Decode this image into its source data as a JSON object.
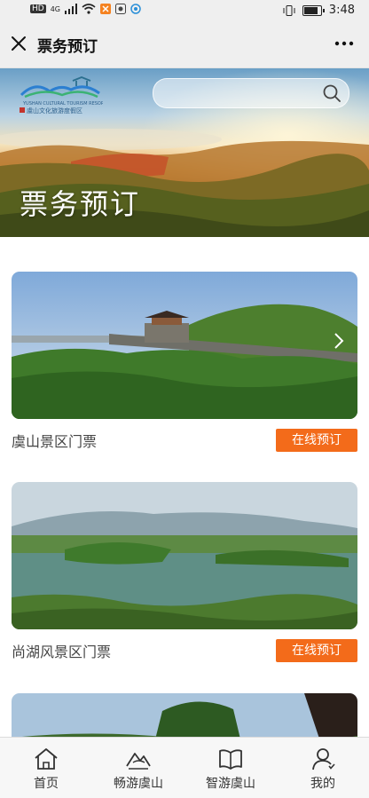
{
  "status_bar": {
    "left_text": "HD",
    "signal_label": "4G",
    "time": "3:48"
  },
  "nav": {
    "title": "票务预订",
    "close_icon": "close-icon",
    "more_icon": "more-icon"
  },
  "banner": {
    "title": "票务预订",
    "logo_text": "虞山文化旅游度假区",
    "logo_subtext": "YUSHAN CULTURAL TOURISM RESORT",
    "search_placeholder": ""
  },
  "tickets": [
    {
      "name": "虞山景区门票",
      "button_label": "在线预订"
    },
    {
      "name": "尚湖风景区门票",
      "button_label": "在线预订"
    },
    {
      "name": "",
      "button_label": ""
    }
  ],
  "tabbar": {
    "items": [
      {
        "label": "首页",
        "icon": "home-icon"
      },
      {
        "label": "畅游虞山",
        "icon": "mountain-icon"
      },
      {
        "label": "智游虞山",
        "icon": "book-icon"
      },
      {
        "label": "我的",
        "icon": "user-icon"
      }
    ]
  },
  "colors": {
    "accent": "#f36b1a",
    "nav_bg": "#efefef"
  }
}
